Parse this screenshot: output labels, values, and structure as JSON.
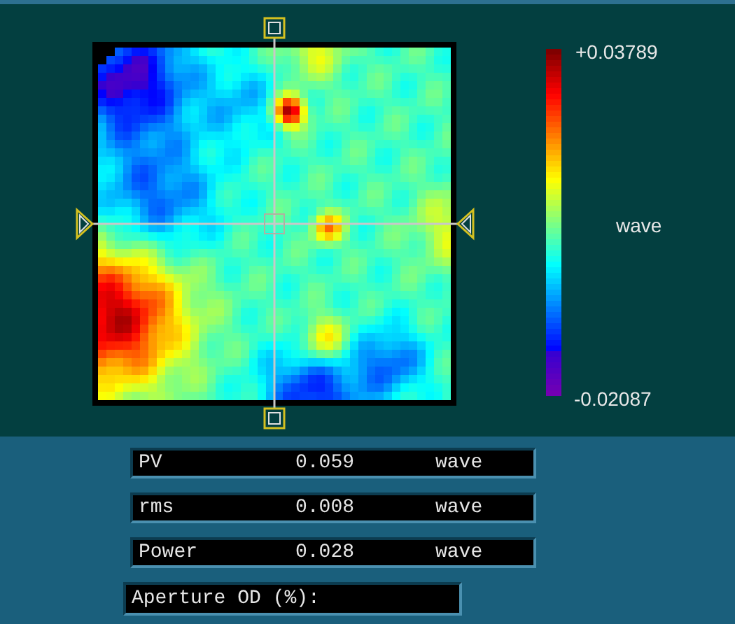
{
  "colorbar": {
    "max_label": "+0.03789",
    "unit": "wave",
    "min_label": "-0.02087"
  },
  "readouts": [
    {
      "label": "PV",
      "value": "0.059",
      "unit": "wave"
    },
    {
      "label": "rms",
      "value": "0.008",
      "unit": "wave"
    },
    {
      "label": "Power",
      "value": "0.028",
      "unit": "wave"
    }
  ],
  "aperture": {
    "label": "Aperture OD (%):"
  }
}
